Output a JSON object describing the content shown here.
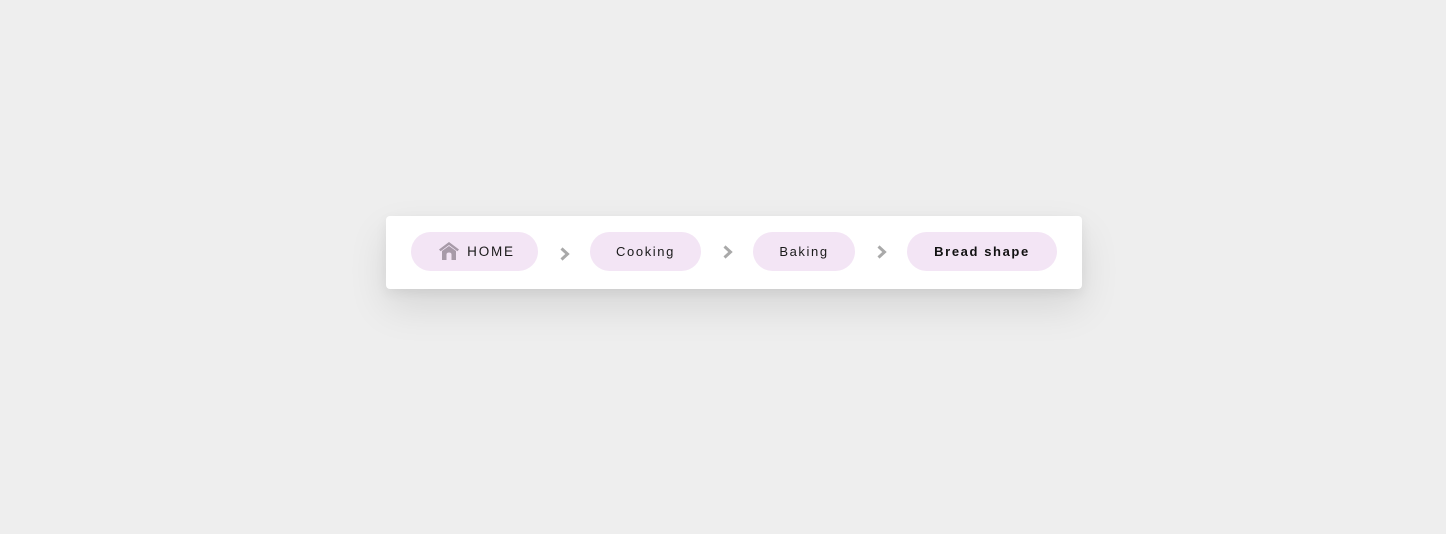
{
  "breadcrumb": {
    "items": [
      {
        "label": "HOME",
        "icon": "home-icon"
      },
      {
        "label": "Cooking"
      },
      {
        "label": "Baking"
      },
      {
        "label": "Bread shape",
        "current": true
      }
    ],
    "separator_icon": "chevron-right-icon"
  },
  "colors": {
    "page_background": "#eeeeee",
    "card_background": "#ffffff",
    "pill_background": "#f3e5f5",
    "icon_color": "#a79aa8",
    "separator_color": "#a9a9a9",
    "text_color": "#1a1a1a"
  }
}
